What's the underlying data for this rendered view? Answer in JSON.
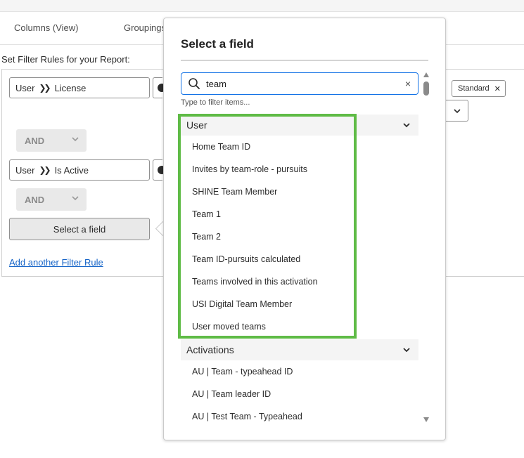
{
  "tabs": {
    "columns": "Columns (View)",
    "groupings": "Groupings"
  },
  "filter_heading": "Set Filter Rules for your Report:",
  "rules": [
    {
      "field": "User",
      "separator_icon": "double-chevron-right-icon",
      "subfield": "License"
    },
    {
      "field": "User",
      "separator_icon": "double-chevron-right-icon",
      "subfield": "Is Active"
    }
  ],
  "operators": [
    "AND",
    "AND"
  ],
  "select_field_button": "Select a field",
  "add_rule_link": "Add another Filter Rule",
  "tag": {
    "label": "Standard",
    "remove": "✕"
  },
  "popover": {
    "title": "Select a field",
    "search": {
      "value": "team",
      "clear": "×",
      "icon": "search-icon"
    },
    "helper": "Type to filter items...",
    "groups": [
      {
        "name": "User",
        "items": [
          "Home Team ID",
          "Invites by team-role - pursuits",
          "SHINE Team Member",
          "Team 1",
          "Team 2",
          "Team ID-pursuits calculated",
          "Teams involved in this activation",
          "USI Digital Team Member",
          "User moved teams"
        ]
      },
      {
        "name": "Activations",
        "items": [
          "AU | Team - typeahead ID",
          "AU | Team leader ID",
          "AU | Test Team - Typeahead"
        ]
      }
    ]
  },
  "colors": {
    "accent": "#1473e6",
    "highlight": "#5fbb46",
    "link": "#1463c7"
  }
}
